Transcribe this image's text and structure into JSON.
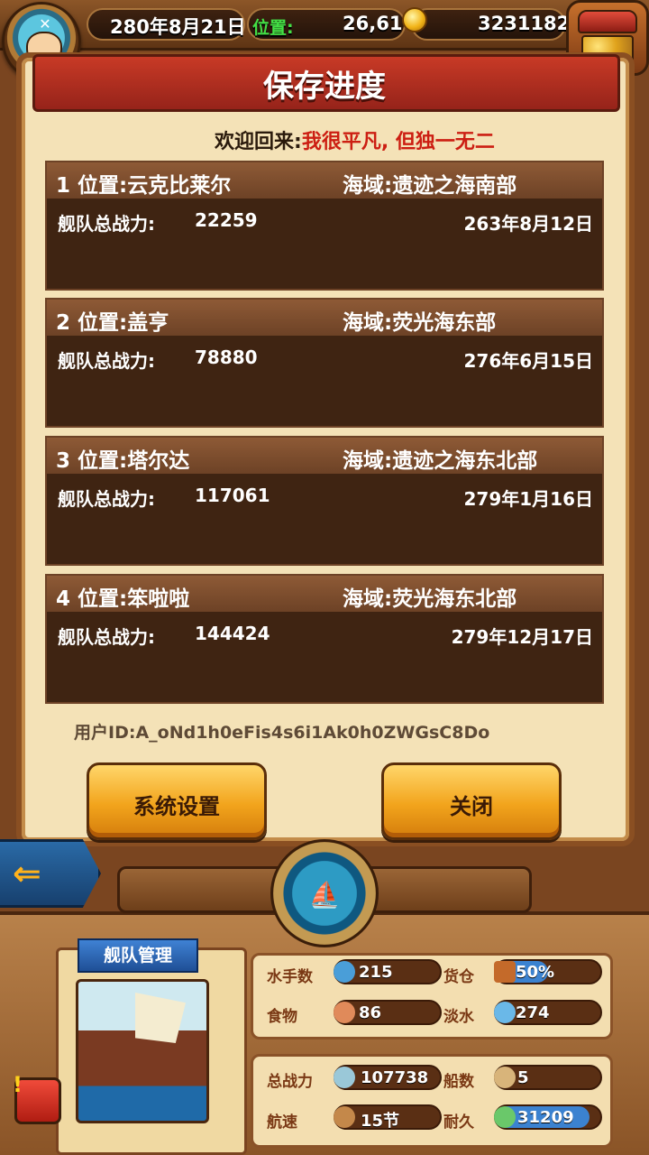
{
  "top": {
    "date": "280年8月21日",
    "pos_label": "位置:",
    "pos_value": "26,61",
    "gold": "3231182"
  },
  "title": "保存进度",
  "welcome": {
    "label": "欢迎回来:",
    "name": "我很平凡, 但独一无二"
  },
  "slots": [
    {
      "loc": "1 位置:云克比莱尔",
      "sea": "海域:遗迹之海南部",
      "power_label": "舰队总战力:",
      "power": "22259",
      "date": "263年8月12日"
    },
    {
      "loc": "2 位置:盖亨",
      "sea": "海域:荧光海东部",
      "power_label": "舰队总战力:",
      "power": "78880",
      "date": "276年6月15日"
    },
    {
      "loc": "3 位置:塔尔达",
      "sea": "海域:遗迹之海东北部",
      "power_label": "舰队总战力:",
      "power": "117061",
      "date": "279年1月16日"
    },
    {
      "loc": "4 位置:笨啦啦",
      "sea": "海域:荧光海东北部",
      "power_label": "舰队总战力:",
      "power": "144424",
      "date": "279年12月17日"
    }
  ],
  "user_id": "用户ID:A_oNd1h0eFis4s6i1Ak0h0ZWGsC8Do",
  "buttons": {
    "settings": "系统设置",
    "close": "关闭"
  },
  "fleet": {
    "title": "舰队管理",
    "sailors_label": "水手数",
    "sailors": "215",
    "cargo_label": "货仓",
    "cargo": "50%",
    "cargo_fill": 0.5,
    "food_label": "食物",
    "food": "86",
    "water_label": "淡水",
    "water": "274",
    "power_label": "总战力",
    "power": "107738",
    "ships_label": "船数",
    "ships": "5",
    "speed_label": "航速",
    "speed": "15节",
    "durability_label": "耐久",
    "durability": "31209",
    "durability_fill": 1
  },
  "colors": {
    "accent_red": "#cc1e12",
    "pos_green": "#44e046",
    "bar_blue": "#3b82d0"
  }
}
